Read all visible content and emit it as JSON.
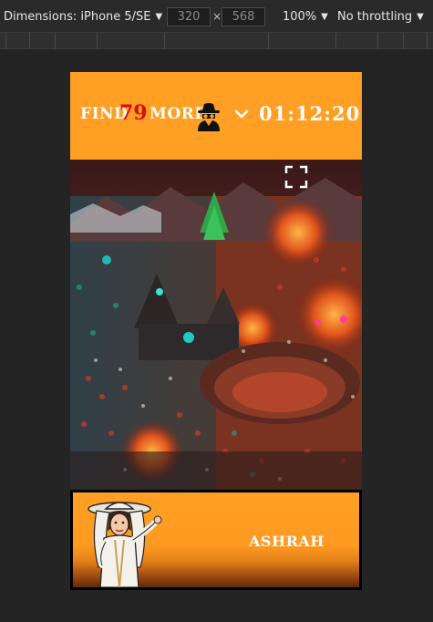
{
  "devtools": {
    "device_label": "Dimensions: iPhone 5/SE",
    "width_value": "320",
    "times": "×",
    "height_value": "568",
    "zoom_label": "100%",
    "throttle_label": "No throttling"
  },
  "game": {
    "find_label": "FIND",
    "remaining_count": "79",
    "more_label": "MORE",
    "timer": "01:12:20",
    "character_name": "ASHRAH"
  },
  "icons": {
    "spy": "spy-icon",
    "dropdown": "chevron-down-icon",
    "fullscreen": "fullscreen-icon"
  },
  "colors": {
    "header_bg": "#ff9f24",
    "count_red": "#d60f0f",
    "devtools_bg": "#2a2a2a"
  }
}
